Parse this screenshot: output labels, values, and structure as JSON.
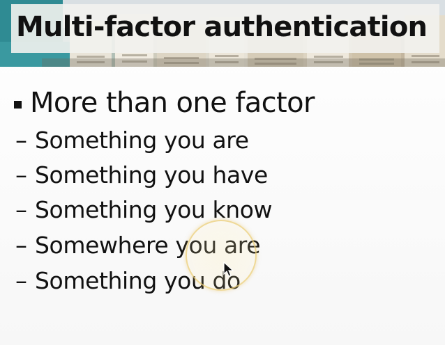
{
  "slide": {
    "title": "Multi-factor authentication",
    "bullet": "More than one factor",
    "sub_items": [
      {
        "dash": "–",
        "label": "Something you are"
      },
      {
        "dash": "–",
        "label": "Something you have"
      },
      {
        "dash": "–",
        "label": "Something you know"
      },
      {
        "dash": "–",
        "label": "Somewhere you are"
      },
      {
        "dash": "–",
        "label": "Something you do"
      }
    ]
  },
  "icons": {
    "bullet": "square-bullet-icon",
    "pointer": "mouse-pointer-icon",
    "highlight": "cursor-highlight-ring"
  },
  "colors": {
    "text": "#111111",
    "title_box": "#f2f2ee",
    "highlight_ring": "#ebcd78"
  }
}
